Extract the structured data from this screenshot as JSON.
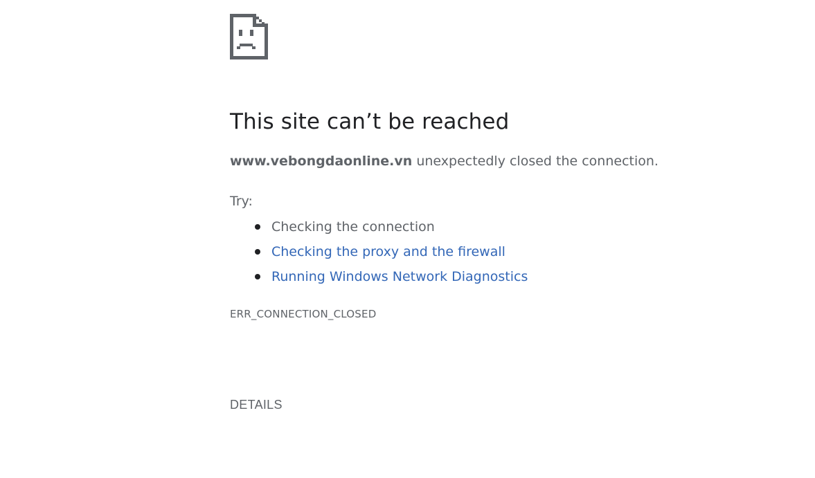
{
  "error_page": {
    "icon": "sad-page-icon",
    "title": "This site can’t be reached",
    "host": "www.vebongdaonline.vn",
    "message_rest": " unexpectedly closed the connection.",
    "try_label": "Try:",
    "suggestions": [
      {
        "label": "Checking the connection",
        "is_link": false
      },
      {
        "label": "Checking the proxy and the firewall",
        "is_link": true
      },
      {
        "label": "Running Windows Network Diagnostics",
        "is_link": true
      }
    ],
    "error_code": "ERR_CONNECTION_CLOSED",
    "details_label": "DETAILS"
  },
  "colors": {
    "heading": "#202124",
    "text": "#5f6368",
    "link": "#3367b7",
    "background": "#ffffff"
  }
}
